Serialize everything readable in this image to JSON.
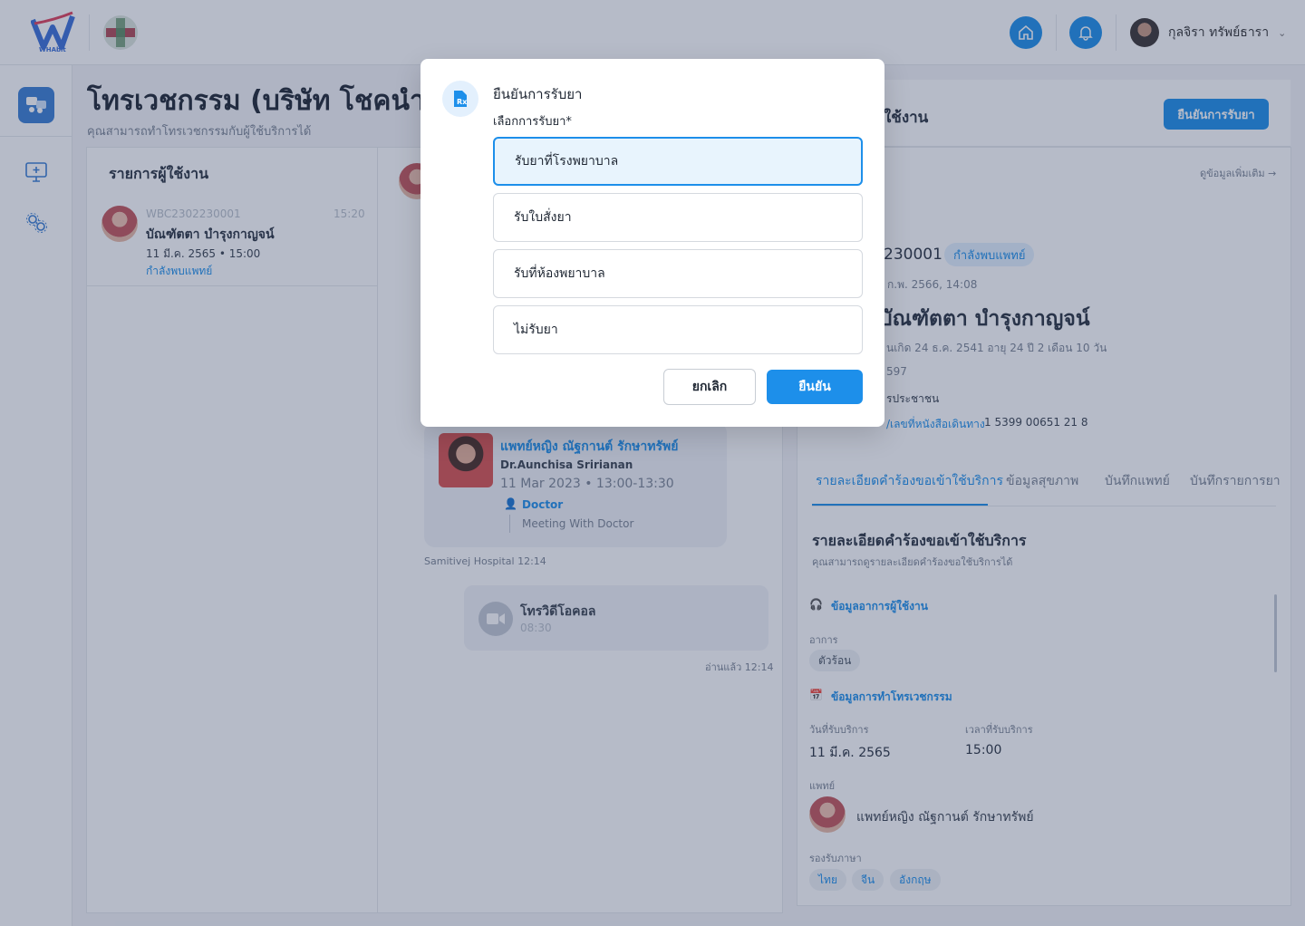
{
  "topbar": {
    "logo_text": "WHAbit",
    "user_name": "กุลจิรา ทรัพย์ธารา"
  },
  "page": {
    "title": "โทรเวชกรรม  (บริษัท โชคนำชัย จำกัด)",
    "subtitle": "คุณสามารถทำโทรเวชกรรมกับผู้ใช้บริการได้"
  },
  "user_list": {
    "heading": "รายการผู้ใช้งาน",
    "item": {
      "code": "WBC2302230001",
      "time": "15:20",
      "name": "บัณฑัตตา บำรุงกาญจน์",
      "datetime": "11 มี.ค. 2565 • 15:00",
      "status": "กำลังพบแพทย์"
    }
  },
  "chat": {
    "doctor_name_th": "แพทย์หญิง ณัฐกานต์ รักษาทรัพย์",
    "doctor_name_en": "Dr.Aunchisa Sririanan",
    "appointment": "11 Mar 2023 • 13:00-13:30",
    "role": "Doctor",
    "meeting": "Meeting With Doctor",
    "hospital_time": "Samitivej Hospital 12:14",
    "video_call_title": "โทรวิดีโอคอล",
    "video_call_time": "08:30",
    "read_time": "อ่านแล้ว 12:14"
  },
  "detail": {
    "header_title": "ใช้งาน",
    "confirm_button": "ยืนยันการรับยา",
    "more_link": "ดูข้อมูลเพิ่มเติม →",
    "code_partial": "230001",
    "status_badge": "กำลังพบแพทย์",
    "date_partial": "ก.พ. 2566, 14:08",
    "name_partial": "บัณฑัตตา บำรุงกาญจน์",
    "birth_partial": "นเกิด 24 ธ.ค. 2541 อายุ 24 ปี  2 เดือน 10 วัน",
    "phone_partial": "597",
    "id_type_partial": "รประชาชน",
    "id_label_partial": "/เลขที่หนังสือเดินทาง",
    "id_number": "1 5399 00651 21 8",
    "tabs": [
      "รายละเอียดคำร้องขอเข้าใช้บริการ",
      "ข้อมูลสุขภาพ",
      "บันทึกแพทย์",
      "บันทึกรายการยา"
    ],
    "section_title": "รายละเอียดคำร้องขอเข้าใช้บริการ",
    "section_sub": "คุณสามารถดูรายละเอียดคำร้องขอใช้บริการได้",
    "symptom_header": "ข้อมูลอาการผู้ใช้งาน",
    "symptom_label": "อาการ",
    "symptom_value": "ตัวร้อน",
    "telemed_header": "ข้อมูลการทำโทรเวชกรรม",
    "service_date_label": "วันที่รับบริการ",
    "service_date": "11 มี.ค. 2565",
    "service_time_label": "เวลาที่รับบริการ",
    "service_time": "15:00",
    "doctor_label": "แพทย์",
    "doctor_name": "แพทย์หญิง ณัฐกานต์ รักษาทรัพย์",
    "language_label": "รองรับภาษา",
    "languages": [
      "ไทย",
      "จีน",
      "อังกฤษ"
    ]
  },
  "modal": {
    "title": "ยืนยันการรับยา",
    "field_label": "เลือกการรับยา*",
    "options": [
      {
        "label": "รับยาที่โรงพยาบาล",
        "selected": true
      },
      {
        "label": "รับใบสั่งยา",
        "selected": false
      },
      {
        "label": "รับที่ห้องพยาบาล",
        "selected": false
      },
      {
        "label": "ไม่รับยา",
        "selected": false
      }
    ],
    "cancel_label": "ยกเลิก",
    "confirm_label": "ยืนยัน"
  },
  "colors": {
    "accent": "#1d8fea",
    "overlay": "rgba(40,55,95,0.34)"
  }
}
